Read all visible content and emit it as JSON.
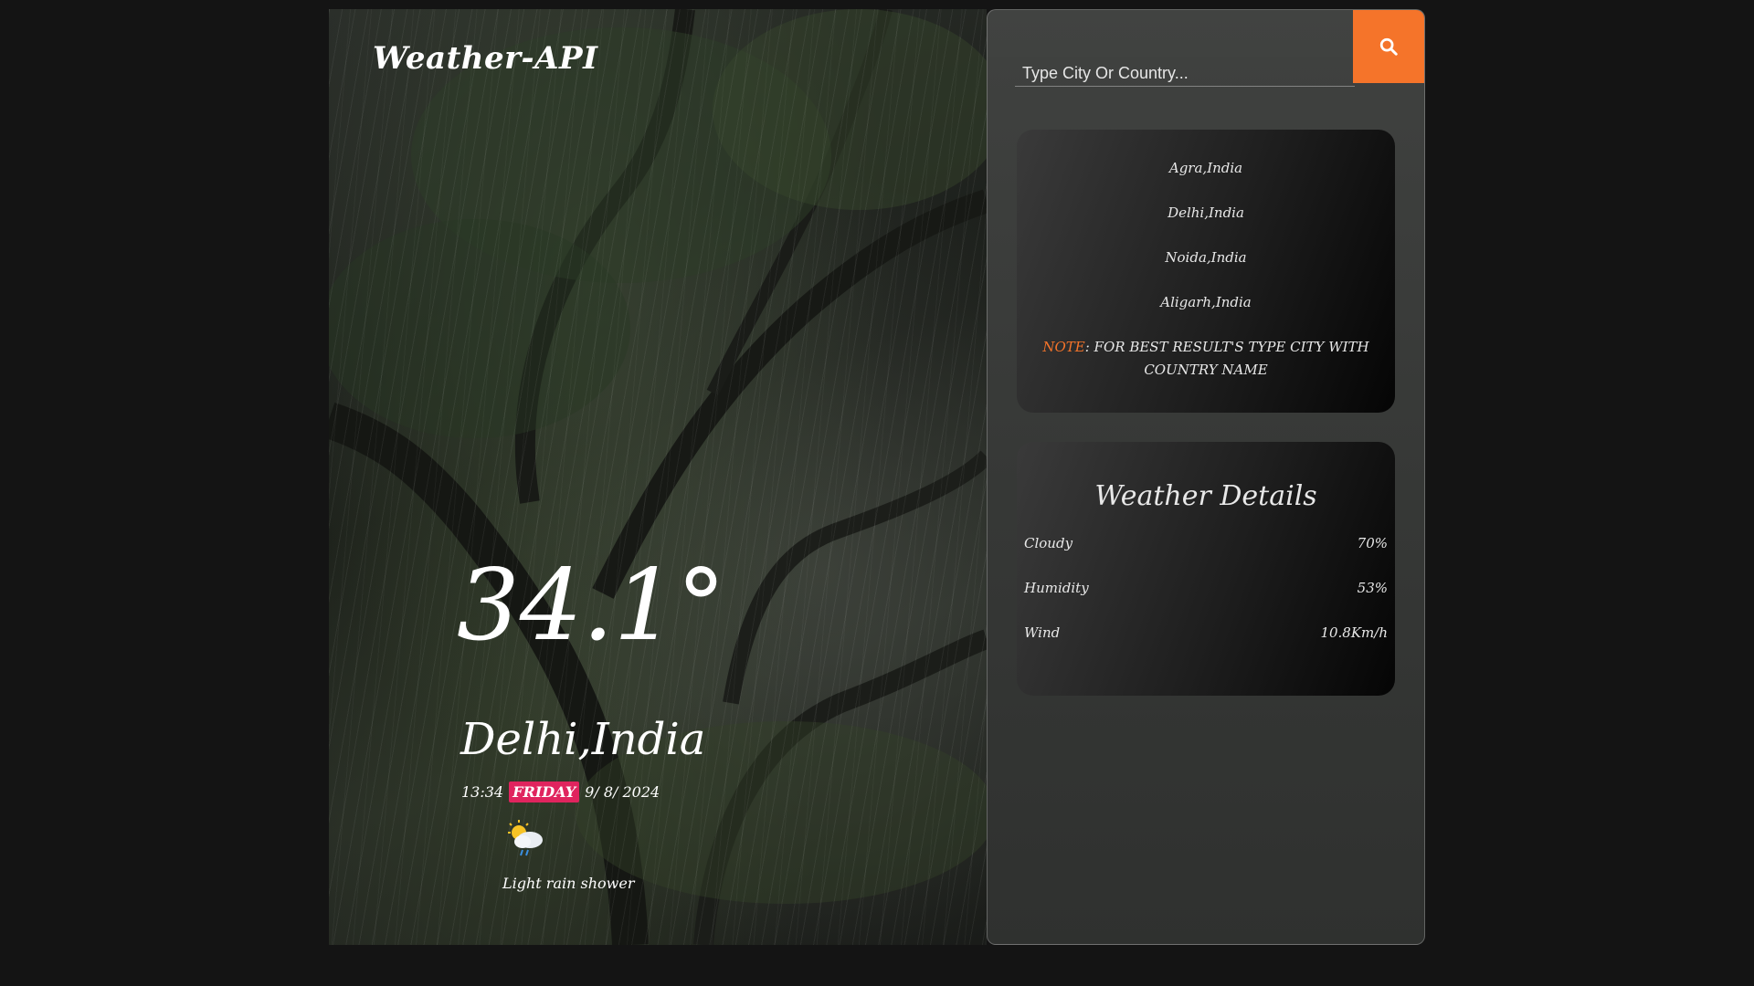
{
  "brand": {
    "title": "Weather-API"
  },
  "current": {
    "temperature": "34.1°",
    "location": "Delhi,India",
    "time": "13:34",
    "day": "FRIDAY",
    "date": "9/ 8/ 2024",
    "condition_icon": "partly-cloudy-rain-icon",
    "condition": "Light rain shower"
  },
  "search": {
    "placeholder": "Type City Or Country...",
    "value": "",
    "button_icon": "search-icon"
  },
  "suggestions": {
    "items": [
      "Agra,India",
      "Delhi,India",
      "Noida,India",
      "Aligarh,India"
    ],
    "note_label": "NOTE",
    "note_text": ": FOR BEST RESULT'S TYPE CITY WITH COUNTRY NAME"
  },
  "details": {
    "title": "Weather Details",
    "rows": [
      {
        "label": "Cloudy",
        "value": "70%"
      },
      {
        "label": "Humidity",
        "value": "53%"
      },
      {
        "label": "Wind",
        "value": "10.8Km/h"
      }
    ]
  },
  "colors": {
    "accent": "#f5742a",
    "day_badge": "#e0245e",
    "background": "#141414"
  }
}
